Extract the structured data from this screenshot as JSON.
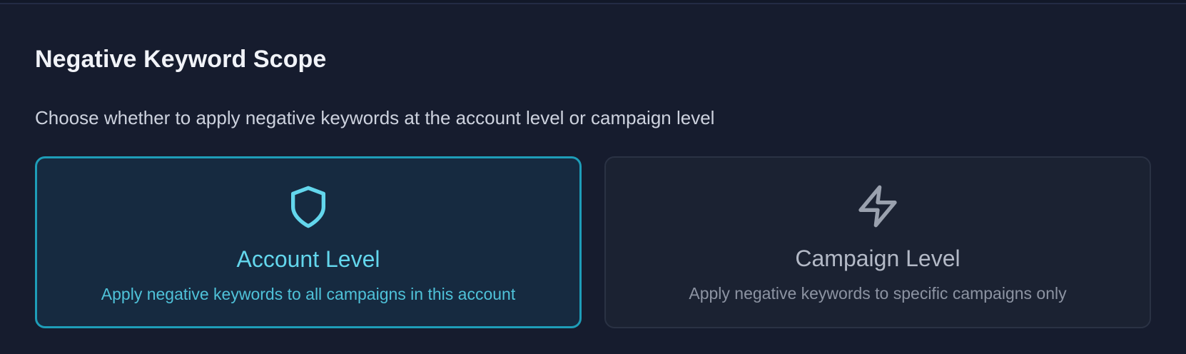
{
  "header": {
    "title": "Negative Keyword Scope",
    "description": "Choose whether to apply negative keywords at the account level or campaign level"
  },
  "options": [
    {
      "icon": "shield-icon",
      "title": "Account Level",
      "description": "Apply negative keywords to all campaigns in this account",
      "selected": true
    },
    {
      "icon": "lightning-bolt-icon",
      "title": "Campaign Level",
      "description": "Apply negative keywords to specific campaigns only",
      "selected": false
    }
  ],
  "colors": {
    "accent": "#1e9db8",
    "accent_text": "#63d6ec",
    "background": "#161c2e",
    "muted_icon": "#9aa1ae"
  }
}
